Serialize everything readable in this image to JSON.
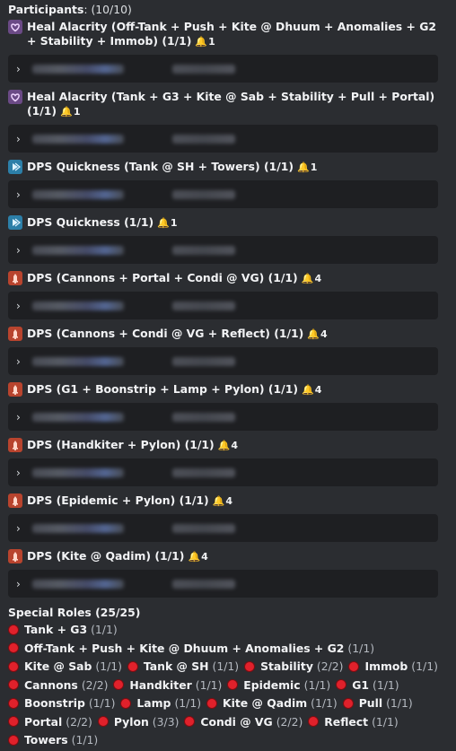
{
  "header": {
    "label": "Participants",
    "count": ": (10/10)"
  },
  "roles": [
    {
      "icon": "heal",
      "name": "Heal Alacrity (Off-Tank + Push + Kite @ Dhuum + Anomalies + G2 + Stability + Immob) (1/1)",
      "bell": "1"
    },
    {
      "icon": "heal",
      "name": "Heal Alacrity (Tank + G3 + Kite @ Sab + Stability + Pull + Portal) (1/1)",
      "bell": "1"
    },
    {
      "icon": "quick",
      "name": "DPS Quickness (Tank @ SH + Towers) (1/1)",
      "bell": "1"
    },
    {
      "icon": "quick",
      "name": "DPS Quickness (1/1)",
      "bell": "1"
    },
    {
      "icon": "dps",
      "name": "DPS (Cannons + Portal + Condi @ VG) (1/1)",
      "bell": "4"
    },
    {
      "icon": "dps",
      "name": "DPS (Cannons + Condi @ VG + Reflect) (1/1)",
      "bell": "4"
    },
    {
      "icon": "dps",
      "name": "DPS (G1 + Boonstrip + Lamp + Pylon) (1/1)",
      "bell": "4"
    },
    {
      "icon": "dps",
      "name": "DPS (Handkiter + Pylon) (1/1)",
      "bell": "4"
    },
    {
      "icon": "dps",
      "name": "DPS (Epidemic + Pylon) (1/1)",
      "bell": "4"
    },
    {
      "icon": "dps",
      "name": "DPS (Kite @ Qadim) (1/1)",
      "bell": "4"
    }
  ],
  "special": {
    "title": "Special Roles (25/25)",
    "chips": [
      {
        "name": "Tank + G3",
        "count": "(1/1)"
      },
      {
        "name": "Off-Tank + Push + Kite @ Dhuum + Anomalies + G2",
        "count": "(1/1)"
      },
      {
        "name": "Kite @ Sab",
        "count": "(1/1)"
      },
      {
        "name": "Tank @ SH",
        "count": "(1/1)"
      },
      {
        "name": "Stability",
        "count": "(2/2)"
      },
      {
        "name": "Immob",
        "count": "(1/1)"
      },
      {
        "name": "Cannons",
        "count": "(2/2)"
      },
      {
        "name": "Handkiter",
        "count": "(1/1)"
      },
      {
        "name": "Epidemic",
        "count": "(1/1)"
      },
      {
        "name": "G1",
        "count": "(1/1)"
      },
      {
        "name": "Boonstrip",
        "count": "(1/1)"
      },
      {
        "name": "Lamp",
        "count": "(1/1)"
      },
      {
        "name": "Kite @ Qadim",
        "count": "(1/1)"
      },
      {
        "name": "Pull",
        "count": "(1/1)"
      },
      {
        "name": "Portal",
        "count": "(2/2)"
      },
      {
        "name": "Pylon",
        "count": "(3/3)"
      },
      {
        "name": "Condi @ VG",
        "count": "(2/2)"
      },
      {
        "name": "Reflect",
        "count": "(1/1)"
      },
      {
        "name": "Towers",
        "count": "(1/1)"
      }
    ]
  },
  "ui": {
    "chevron_icon": "chevron-right-icon",
    "bell_icon": "bell-icon",
    "bell_color": "#f0b232",
    "dot_color": "#e0212b"
  }
}
